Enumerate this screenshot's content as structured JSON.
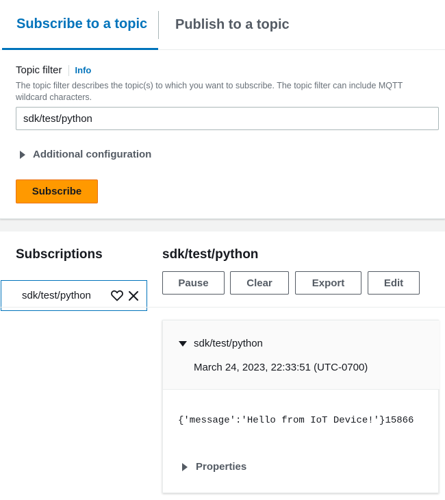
{
  "tabs": [
    {
      "label": "Subscribe to a topic",
      "active": true
    },
    {
      "label": "Publish to a topic",
      "active": false
    }
  ],
  "subscribe_form": {
    "field_label": "Topic filter",
    "info_link": "Info",
    "description": "The topic filter describes the topic(s) to which you want to subscribe. The topic filter can include MQTT wildcard characters.",
    "topic_value": "sdk/test/python",
    "additional_config": "Additional configuration",
    "subscribe_button": "Subscribe"
  },
  "subscriptions": {
    "title": "Subscriptions",
    "items": [
      {
        "topic": "sdk/test/python"
      }
    ]
  },
  "topic_view": {
    "title": "sdk/test/python",
    "buttons": {
      "pause": "Pause",
      "clear": "Clear",
      "export": "Export",
      "edit": "Edit"
    },
    "message": {
      "topic": "sdk/test/python",
      "timestamp": "March 24, 2023, 22:33:51 (UTC-0700)",
      "payload": "{'message':'Hello from IoT Device!'}15866",
      "properties_label": "Properties"
    }
  },
  "colors": {
    "accent": "#0073bb",
    "primary_button": "#ff9900",
    "text": "#16191f"
  }
}
